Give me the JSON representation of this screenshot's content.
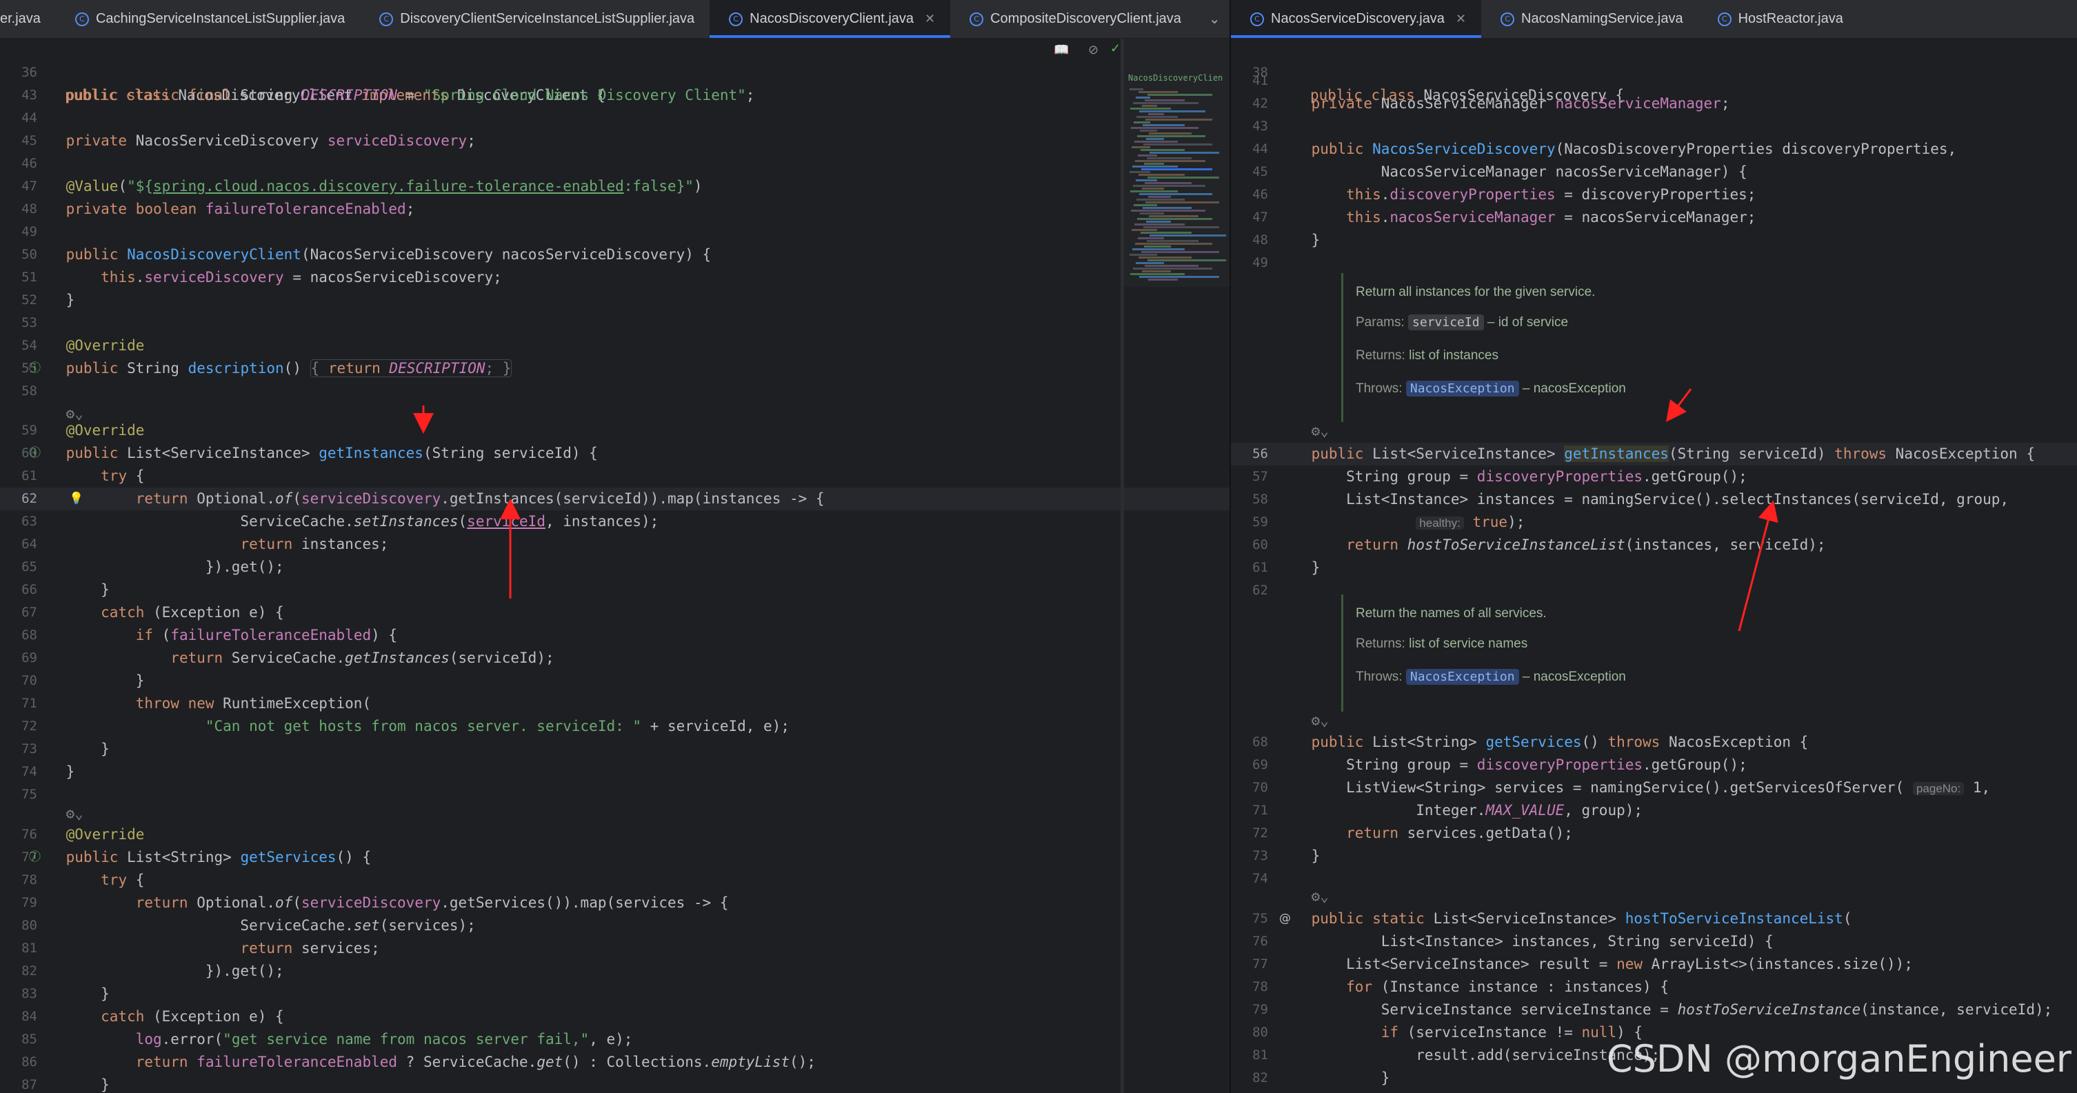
{
  "left": {
    "tabs": [
      {
        "label": "er.java",
        "active": false
      },
      {
        "label": "CachingServiceInstanceListSupplier.java",
        "active": false
      },
      {
        "label": "DiscoveryClientServiceInstanceListSupplier.java",
        "active": false
      },
      {
        "label": "NacosDiscoveryClient.java",
        "active": true,
        "closable": true
      },
      {
        "label": "CompositeDiscoveryClient.java",
        "active": false
      }
    ],
    "header_line_number": "36",
    "header_code": "public class NacosDiscoveryClient implements DiscoveryClient {",
    "minimap_label": "NacosDiscoveryClien",
    "line_numbers": [
      "43",
      "44",
      "45",
      "46",
      "47",
      "48",
      "49",
      "50",
      "51",
      "52",
      "53",
      "54",
      "55",
      "58",
      "",
      "59",
      "60",
      "61",
      "62",
      "63",
      "64",
      "65",
      "66",
      "67",
      "68",
      "69",
      "70",
      "71",
      "72",
      "73",
      "74",
      "75",
      "",
      "76",
      "77",
      "78",
      "79",
      "80",
      "81",
      "82",
      "83",
      "84",
      "85",
      "86",
      "87"
    ]
  },
  "right": {
    "tabs": [
      {
        "label": "NacosServiceDiscovery.java",
        "active": true,
        "closable": true
      },
      {
        "label": "NacosNamingService.java",
        "active": false
      },
      {
        "label": "HostReactor.java",
        "active": false
      }
    ],
    "header_line_number": "38",
    "header_code": "public class NacosServiceDiscovery {",
    "doc1": {
      "summary": "Return all instances for the given service.",
      "params_label": "Params:",
      "param_name": "serviceId",
      "param_desc": "– id of service",
      "returns_label": "Returns:",
      "returns_desc": "list of instances",
      "throws_label": "Throws:",
      "throws_type": "NacosException",
      "throws_desc": "– nacosException"
    },
    "doc2": {
      "summary": "Return the names of all services.",
      "returns_label": "Returns:",
      "returns_desc": "list of service names",
      "throws_label": "Throws:",
      "throws_type": "NacosException",
      "throws_desc": "– nacosException"
    },
    "hints": {
      "healthy": "healthy:",
      "page_no": "pageNo:"
    }
  },
  "watermark": "CSDN @morganEngineer"
}
